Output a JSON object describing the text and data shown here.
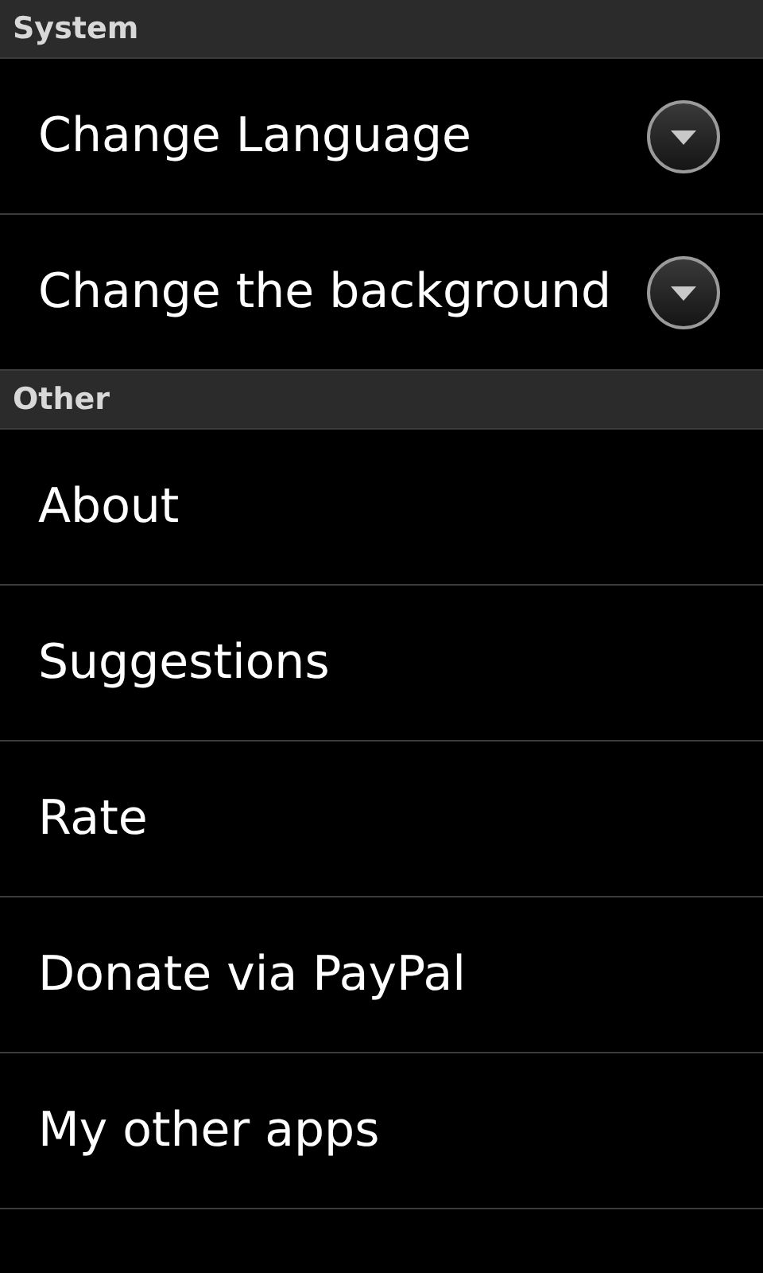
{
  "sections": [
    {
      "title": "System",
      "items": [
        {
          "label": "Change Language",
          "kind": "dropdown"
        },
        {
          "label": "Change the background",
          "kind": "dropdown"
        }
      ]
    },
    {
      "title": "Other",
      "items": [
        {
          "label": "About",
          "kind": "plain"
        },
        {
          "label": "Suggestions",
          "kind": "plain"
        },
        {
          "label": "Rate",
          "kind": "plain"
        },
        {
          "label": "Donate via PayPal",
          "kind": "plain"
        },
        {
          "label": "My other apps",
          "kind": "plain"
        }
      ]
    }
  ]
}
